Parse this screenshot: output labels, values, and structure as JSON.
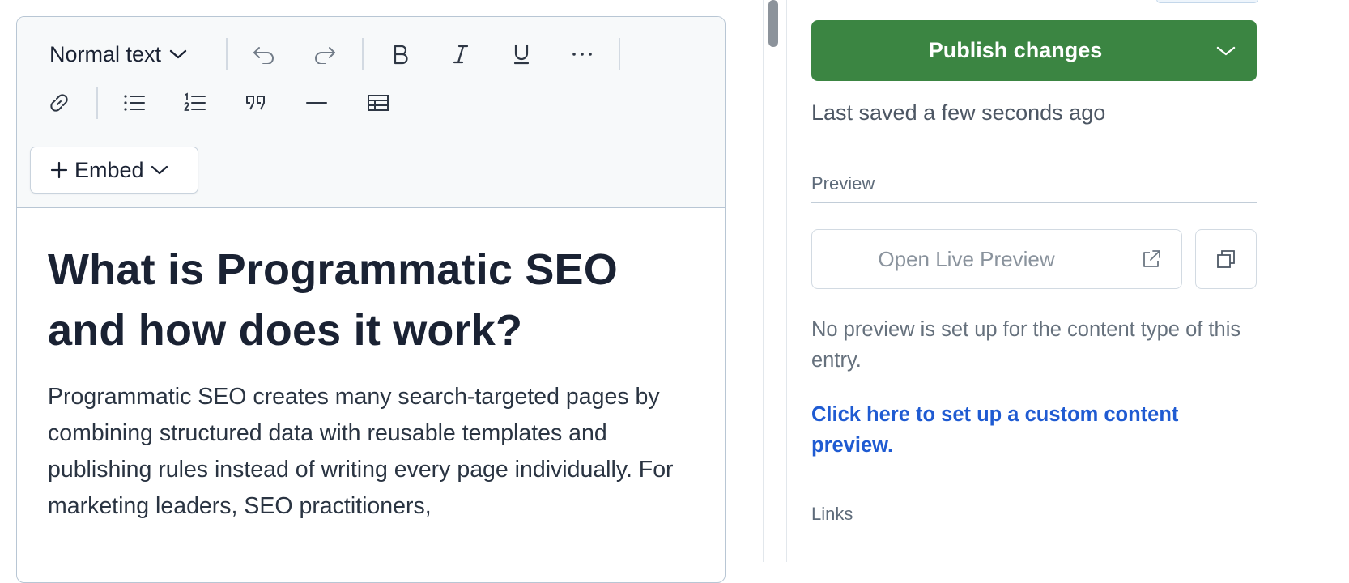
{
  "editor": {
    "toolbar": {
      "text_style": "Normal text",
      "embed_label": "Embed"
    },
    "title": "What is Programmatic SEO and how does it work?",
    "body": "Programmatic SEO creates many search-targeted pages by combining structured data with reusable templates and publishing rules instead of writing every page individually. For marketing leaders, SEO practitioners,"
  },
  "sidebar": {
    "publish_label": "Publish changes",
    "last_saved": "Last saved a few seconds ago",
    "preview_heading": "Preview",
    "open_live_preview": "Open Live Preview",
    "no_preview_text": "No preview is set up for the content type of this entry.",
    "custom_preview_link": "Click here to set up a custom content preview.",
    "links_heading": "Links"
  },
  "colors": {
    "publish_green": "#3b8542",
    "link_blue": "#1f5bd2",
    "toolbar_bg": "#f7f9fa"
  },
  "icons": [
    "chevron-down-icon",
    "undo-icon",
    "redo-icon",
    "bold-icon",
    "italic-icon",
    "underline-icon",
    "more-icon",
    "link-icon",
    "bulleted-list-icon",
    "numbered-list-icon",
    "quote-icon",
    "horizontal-rule-icon",
    "table-icon",
    "plus-icon",
    "external-link-icon",
    "copy-icon"
  ]
}
